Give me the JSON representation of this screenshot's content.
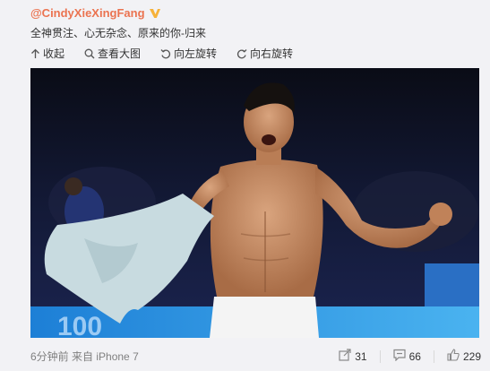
{
  "post": {
    "author": "@CindyXieXingFang",
    "text": "全神贯注、心无杂念、原来的你-归来",
    "toolbar": {
      "collapse": "收起",
      "view_large": "查看大图",
      "rotate_left": "向左旋转",
      "rotate_right": "向右旋转"
    },
    "time": "6分钟前",
    "source": "来自 iPhone 7",
    "reposts": "31",
    "comments": "66",
    "likes": "229"
  },
  "colors": {
    "author": "#eb7350",
    "vbadge": "#f6b23a",
    "text": "#333333",
    "meta": "#808080"
  },
  "icons": {
    "collapse": "arrow-up-icon",
    "view_large": "magnifier-icon",
    "rotate_left": "rotate-left-icon",
    "rotate_right": "rotate-right-icon",
    "repost": "share-icon",
    "comment": "comment-icon",
    "like": "thumbs-up-icon"
  }
}
